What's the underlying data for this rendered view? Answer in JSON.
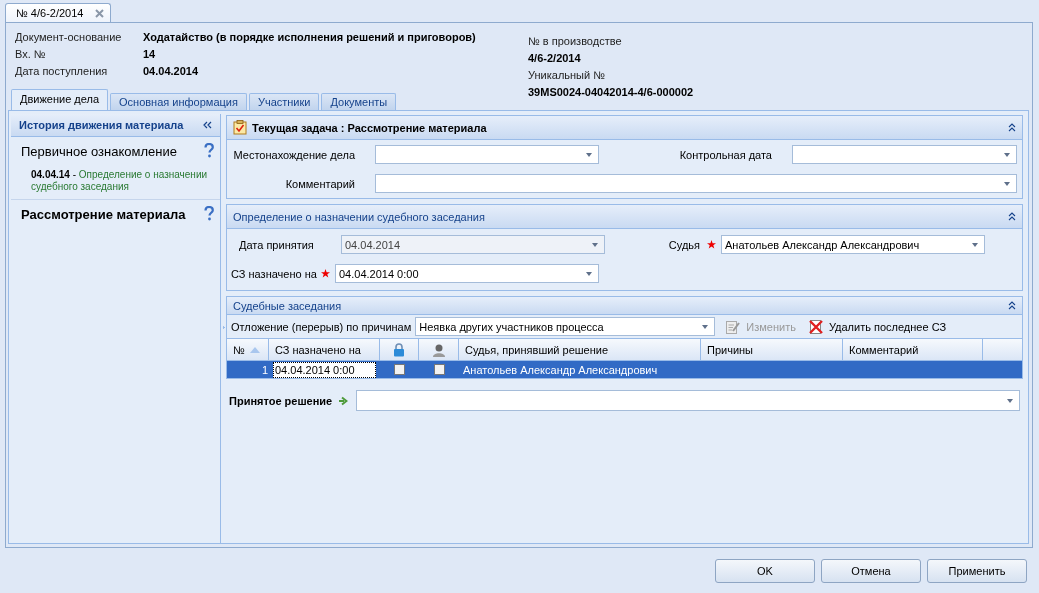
{
  "document_tab": {
    "label": "№ 4/6-2/2014"
  },
  "header": {
    "left": [
      {
        "label": "Документ-основание",
        "value": "Ходатайство (в порядке исполнения решений и приговоров)"
      },
      {
        "label": "Вх. №",
        "value": "14"
      },
      {
        "label": "Дата поступления",
        "value": "04.04.2014"
      }
    ],
    "right": [
      {
        "label": "№ в производстве",
        "value": "4/6-2/2014"
      },
      {
        "label": "Уникальный №",
        "value": "39MS0024-04042014-4/6-000002"
      }
    ]
  },
  "tabs": [
    {
      "label": "Движение дела",
      "selected": true
    },
    {
      "label": "Основная информация",
      "selected": false
    },
    {
      "label": "Участники",
      "selected": false
    },
    {
      "label": "Документы",
      "selected": false
    }
  ],
  "history_panel": {
    "title": "История движения материала",
    "stages": [
      {
        "title": "Первичное ознакомление",
        "current": false,
        "entries": [
          {
            "date": "04.04.14",
            "separator": "-",
            "text": "Определение о назначении судебного заседания"
          }
        ]
      },
      {
        "title": "Рассмотрение материала",
        "current": true
      }
    ]
  },
  "current_task": {
    "title": "Текущая задача : Рассмотрение материала",
    "location": {
      "label": "Местонахождение дела"
    },
    "control_date": {
      "label": "Контрольная дата"
    },
    "comment": {
      "label": "Комментарий"
    }
  },
  "decision_section": {
    "title": "Определение о назначении судебного заседания",
    "date_accepted": {
      "label": "Дата принятия",
      "value": "04.04.2014",
      "disabled": true,
      "required": false
    },
    "judge": {
      "label": "Судья",
      "value": "Анатольев Александр Александрович",
      "disabled": false,
      "required": true
    },
    "session_date": {
      "label": "СЗ назначено на",
      "value": "04.04.2014 0:00",
      "disabled": false,
      "required": true
    }
  },
  "sessions": {
    "title": "Судебные заседания",
    "postponement": {
      "label": "Отложение (перерыв) по причинам",
      "value": "Неявка других участников процесса"
    },
    "actions": [
      {
        "label": "Изменить",
        "disabled": true
      },
      {
        "label": "Удалить последнее СЗ",
        "disabled": false
      }
    ],
    "columns": [
      {
        "kind": "text",
        "label": "№",
        "sorted": true
      },
      {
        "kind": "text",
        "label": "СЗ назначено на",
        "sorted": false
      },
      {
        "kind": "lock"
      },
      {
        "kind": "user"
      },
      {
        "kind": "text",
        "label": "Судья, принявший решение",
        "sorted": false
      },
      {
        "kind": "text",
        "label": "Причины",
        "sorted": false
      },
      {
        "kind": "text",
        "label": "Комментарий",
        "sorted": false
      }
    ],
    "rows": [
      {
        "number": "1",
        "date": "04.04.2014 0:00",
        "locked": false,
        "flag": false,
        "judge": "Анатольев Александр Александрович",
        "selected": true
      }
    ]
  },
  "accepted_decision": {
    "label": "Принятое решение"
  },
  "buttons": [
    "OK",
    "Отмена",
    "Применить"
  ]
}
